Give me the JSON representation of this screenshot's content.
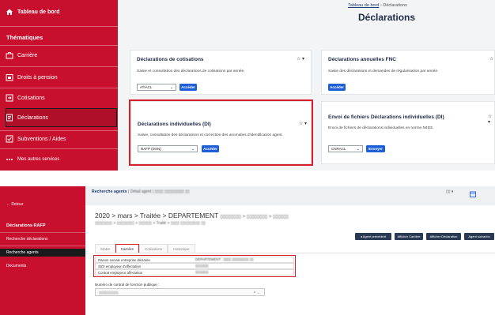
{
  "top": {
    "sidebar": {
      "dashboard": "Tableau de bord",
      "section": "Thématiques",
      "items": [
        {
          "label": "Carrière",
          "icon": "briefcase-icon"
        },
        {
          "label": "Droits à pension",
          "icon": "calendar-icon"
        },
        {
          "label": "Cotisations",
          "icon": "arrow-in-icon"
        },
        {
          "label": "Déclarations",
          "icon": "document-icon"
        },
        {
          "label": "Subventions / Aides",
          "icon": "check-square-icon"
        },
        {
          "label": "Mes autres services",
          "icon": "dots-icon"
        }
      ]
    },
    "breadcrumb": {
      "home": "Tableau de bord",
      "sep": "›",
      "current": "Déclarations"
    },
    "title": "Déclarations",
    "cards": [
      {
        "title": "Déclarations de cotisations",
        "desc": "Saisie et consultation des déclarations de cotisations par année.",
        "select": "ATIACL",
        "button": "Accéder"
      },
      {
        "title": "Déclarations annuelles FNC",
        "desc": "Saisie des déclarations et demandes de régularisation par année.",
        "button": "Accéder"
      },
      {
        "title": "Déclarations individuelles (DI)",
        "desc": "Saisie, consultation des déclarations et correction des anomalies d'identification agent.",
        "select": "RAFP (DSN)",
        "button": "Accéder"
      },
      {
        "title": "Envoi de fichiers Déclarations individuelles (DI)",
        "desc": "Envoi de fichiers de déclarations individuelles en norme N4DS.",
        "select": "CNRACL",
        "button": "Envoyer"
      }
    ],
    "star": "☆ ▾"
  },
  "bottom": {
    "sidebar": {
      "back": "Retour",
      "title": "Déclarations RAFP",
      "items": [
        "Recherche déclarations",
        "Recherche agents",
        "Documents"
      ]
    },
    "topbar": {
      "label": "Recherche agents",
      "sep": " | ",
      "agent": "Détail agent | ▯▯▯▯ ▯▯▯▯▯▯▯▯▯ ▯▯"
    },
    "heading": "2020 > mars > Traitée > DEPARTEMENT",
    "heading_blur": "▯▯▯▯▯▯▯▯ > ▯▯▯▯▯▯▯▯ > ▯▯▯▯▯▯",
    "subheading": "▯▯▯▯▯▯▯▯ > ▯▯▯▯▯▯▯▯ > ▯▯▯▯▯▯ > Traité > ▯▯▯▯ ▯▯▯▯▯▯▯▯▯ ▯▯",
    "actions": [
      "◂ Agent précédent",
      "Afficher Carrière",
      "Afficher Déclaration",
      "Agent suivant ▸"
    ],
    "tabs": [
      "Statut",
      "Carrière",
      "Cotisations",
      "Historique"
    ],
    "rows": [
      {
        "k": "Raison sociale entreprise déclarée",
        "v": "DEPARTEMENT : ▯▯▯▯ ▯▯▯▯▯▯▯▯▯ ▯▯"
      },
      {
        "k": "SIOI employeur d'affectation",
        "v": "▯▯▯▯▯▯▯"
      },
      {
        "k": "Contrat employeur affectation",
        "v": "▯▯▯▯▯▯▯"
      }
    ],
    "field_label": "Numéro de contrat de fonction publique :",
    "field_value": "▯▯▯▯▯▯▯▯▯▯",
    "field_clear": "× ⌄",
    "top_right": "▯▯ ▾"
  }
}
